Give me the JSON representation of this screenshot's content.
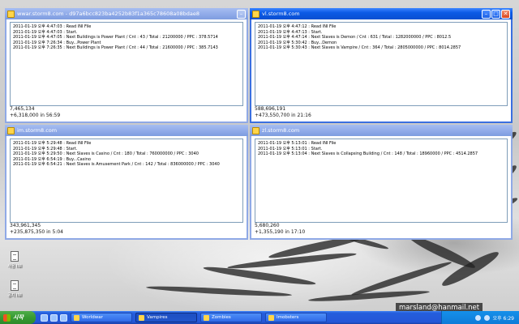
{
  "windows": [
    {
      "title": "wwar.storm8.com - d97a6bcc823ba4252b83f1a365c78608a08bdae8",
      "lines": [
        "2011-01-19 오후 4:47:03 : Read INI File",
        "2011-01-19 오후 4:47:03 : Start.",
        "2011-01-19 오후 4:47:05 : Next Buildings is Power Plant / Cnt : 43 / Total : 21200000 / PPC : 378.5714",
        "2011-01-19 오후 7:26:34 : Buy...Power Plant",
        "2011-01-19 오후 7:26:35 : Next Buildings is Power Plant / Cnt : 44 / Total : 21600000 / PPC : 385.7143"
      ],
      "status_line1": "7,465,134",
      "status_line2": "+6,318,000 in 56:59"
    },
    {
      "title": "vl.storm8.com",
      "lines": [
        "2011-01-19 오후 4:47:12 : Read INI File",
        "2011-01-19 오후 4:47:13 : Start.",
        "2011-01-19 오후 4:47:14 : Next Slaves is Demon / Cnt : 631 / Total : 1282000000 / PPC : 8012.5",
        "2011-01-19 오후 5:30:42 : Buy...Demon",
        "2011-01-19 오후 5:30:43 : Next Slaves is Vampire / Cnt : 364 / Total : 2805000000 / PPC : 8014.2857"
      ],
      "status_line1": "588,696,191",
      "status_line2": "+473,550,700 in 21:16"
    },
    {
      "title": "im.storm8.com",
      "lines": [
        "2011-01-19 오후 5:29:48 : Read INI File",
        "2011-01-19 오후 5:29:48 : Start.",
        "2011-01-19 오후 5:29:50 : Next Slaves is Casino / Cnt : 180 / Total : 760000000 / PPC : 3040",
        "2011-01-19 오후 6:54:19 : Buy...Casino",
        "2011-01-19 오후 6:54:21 : Next Slaves is Amusement Park / Cnt : 142 / Total : 836000000 / PPC : 3040"
      ],
      "status_line1": "343,961,345",
      "status_line2": "+235,875,350 in 5:04"
    },
    {
      "title": "zl.storm8.com",
      "lines": [
        "2011-01-19 오후 5:13:01 : Read INI File",
        "2011-01-19 오후 5:13:01 : Start.",
        "2011-01-19 오후 5:13:04 : Next Slaves is Collapsing Building / Cnt : 148 / Total : 18960000 / PPC : 4514.2857"
      ],
      "status_line1": "5,680,260",
      "status_line2": "+1,355,190 in 17:10"
    }
  ],
  "desktop_icons": [
    {
      "label": "사용 INI",
      "icon": "document-icon"
    },
    {
      "label": "공지 INI",
      "icon": "document-icon"
    }
  ],
  "taskbar": {
    "start_label": "시작",
    "tasks": [
      {
        "label": "Worldwar",
        "active": false
      },
      {
        "label": "Vampires",
        "active": true
      },
      {
        "label": "Zombies",
        "active": false
      },
      {
        "label": "Imobsters",
        "active": false
      }
    ],
    "clock": "오후 6:29"
  },
  "watermark": "marsland@hanmail.net",
  "colors": {
    "titlebar_active": "#0b5ae6",
    "titlebar_inactive": "#8ea9e8",
    "window_border": "#3a6fe0",
    "taskbar": "#245edc",
    "start_button": "#379a32"
  }
}
